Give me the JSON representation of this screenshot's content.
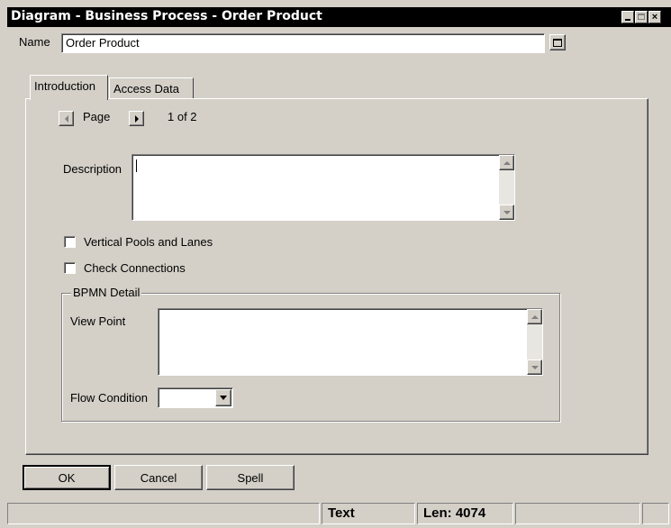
{
  "window": {
    "title": "Diagram - Business Process - Order Product",
    "controls": [
      "minimize-icon",
      "maximize-icon",
      "close-icon"
    ]
  },
  "name_field": {
    "label": "Name",
    "value": "Order Product"
  },
  "tabs": [
    {
      "label": "Introduction",
      "active": true
    },
    {
      "label": "Access Data",
      "active": false
    }
  ],
  "pager": {
    "label": "Page",
    "value": "1 of 2"
  },
  "description": {
    "label": "Description",
    "value": ""
  },
  "checkboxes": [
    {
      "label": "Vertical Pools and Lanes",
      "checked": false
    },
    {
      "label": "Check Connections",
      "checked": false
    }
  ],
  "bpmn": {
    "legend": "BPMN Detail",
    "view_point_label": "View Point",
    "view_point_value": "",
    "flow_condition_label": "Flow Condition",
    "flow_condition_value": ""
  },
  "buttons": {
    "ok": "OK",
    "cancel": "Cancel",
    "spell": "Spell"
  },
  "status_bar": {
    "mode": "Text",
    "length": "Len: 4074"
  },
  "colors": {
    "face": "#d4d0c8",
    "title_bar": "#000000",
    "field": "#ffffff"
  }
}
